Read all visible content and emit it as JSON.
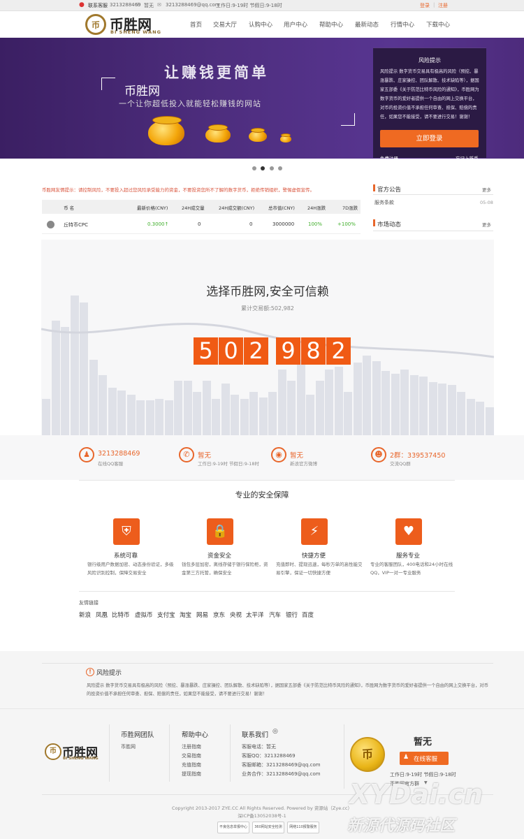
{
  "topbar": {
    "service_label": "联系客服",
    "qq": "3213288469",
    "phone": "暂无",
    "email": "3213288469@qq.com",
    "hours": "工作日:9-19时 节假日:9-18时",
    "login": "登录",
    "register": "注册",
    "separator": "|"
  },
  "nav": {
    "logo_cn": "币胜网",
    "logo_en": "BI SHENG WANG",
    "items": [
      "首页",
      "交易大厅",
      "认购中心",
      "用户中心",
      "帮助中心",
      "最新动态",
      "行情中心",
      "下载中心"
    ]
  },
  "banner": {
    "slogan": "让赚钱更简单",
    "brand": "币胜网",
    "tagline": "一个让你超低投入就能轻松赚钱的网站",
    "risk_title": "风险提示",
    "risk_text": "风险提示 数字货币交易具有极高的风险（预挖、暴涨暴跌、庄家操控、团队解散、技术缺陷等），据国家五部委《关于防范比特币风险的通知》，币胜网为数字货币的爱好者提供一个自由的网上交换平台，对币的投资价值不承担任何审查、担保、赔偿的责任，如果您不能接受，请不要进行交易！谢谢！",
    "login_button": "立即登录",
    "free_register": "免费注册",
    "forgot": "忘记上新币",
    "dots": 4,
    "active_dot": 1
  },
  "notice": "币胜网友情提示：请控制风险，不要投入超过您风险承受能力的资金，不要投资您所不了解的数字货币，拒绝传销组织，警惕虚假宣传。",
  "market": {
    "headers": [
      "币 名",
      "最新价格(CNY)",
      "24H成交量",
      "24H成交额(CNY)",
      "总市值(CNY)",
      "24H涨跌",
      "7D涨跌"
    ],
    "rows": [
      {
        "name": "丘特币CPC",
        "price": "0.3000↑",
        "volume": "0",
        "amount": "0",
        "cap": "3000000",
        "change24": "100%",
        "change7d": "+100%"
      }
    ]
  },
  "sidebar": {
    "announce_title": "官方公告",
    "announce_more": "更多",
    "announce_item": "服务条款",
    "announce_date": "05-08",
    "news_title": "市场动态",
    "news_more": "更多"
  },
  "stats": {
    "title": "选择币胜网,安全可信赖",
    "subtitle": "累计交易额:502,982",
    "digits": [
      "5",
      "0",
      "2",
      "9",
      "8",
      "2"
    ]
  },
  "contacts": [
    {
      "icon": "qq-icon",
      "title": "3213288469",
      "sub": "在线QQ客服"
    },
    {
      "icon": "phone-icon",
      "title": "暂无",
      "sub": "工作日:9-19时 节假日:9-18时"
    },
    {
      "icon": "weibo-icon",
      "title": "暂无",
      "sub": "新浪官方微博"
    },
    {
      "icon": "group-icon",
      "title": "2群：339537450",
      "sub": "交流QQ群"
    }
  ],
  "security": {
    "title": "专业的安全保障",
    "features": [
      {
        "icon": "shield-icon",
        "title": "系统可靠",
        "desc": "银行级用户数据加密、动态身份验证，多级风险识别控制，保障交易安全"
      },
      {
        "icon": "lock-icon",
        "title": "资金安全",
        "desc": "钱包多层加密，离线存储于银行保险柜，资金第三方托管，确保安全"
      },
      {
        "icon": "bolt-icon",
        "title": "快捷方便",
        "desc": "充值即时、提现迅速，每秒万单的高性能交易引擎，保证一切快捷方便"
      },
      {
        "icon": "heart-icon",
        "title": "服务专业",
        "desc": "专业的客服团队，400电话和24小时在线QQ，VIP一对一专业服务"
      }
    ]
  },
  "links": {
    "title": "友情链接",
    "items": [
      "新浪",
      "凤凰",
      "比特币",
      "虚拟币",
      "支付宝",
      "淘宝",
      "网易",
      "京东",
      "央视",
      "太平洋",
      "汽车",
      "银行",
      "百度"
    ]
  },
  "risk_footer": {
    "title": "风险提示",
    "text": "风险提示 数字货币交易具有极高的风险（预挖、暴涨暴跌、庄家操控、团队解散、技术缺陷等），据国家五部委《关于防范比特币风险的通知》，币胜网为数字货币的爱好者提供一个自由的网上交换平台，对币的投资价值不承担任何审查、担保、赔偿的责任，如果您不能接受，请不要进行交易！谢谢！"
  },
  "footer": {
    "col1_title": "币胜网团队",
    "col1_items": [
      "币胜网"
    ],
    "col2_title": "帮助中心",
    "col2_items": [
      "注册指南",
      "交易指南",
      "充值指南",
      "提现指南"
    ],
    "col3_title": "联系我们",
    "col3_items": [
      "客服电话：暂无",
      "客服QQ：3213288469",
      "客服邮箱：3213288469@qq.com",
      "业务合作：3213288469@qq.com"
    ],
    "service_title": "暂无",
    "online_button": "在线客服",
    "hours": "工作日:9-19时 节假日:9-18时",
    "group": "币胜网官方群",
    "copyright": "Copyright 2013-2017 ZYE.CC All Rights Reserved. Powered by 资源站（Zye.cc）",
    "icp": "深ICP备13052038号-1",
    "badges": [
      "不良信息举报中心",
      "360网站安全检测",
      "网络110报警服务"
    ],
    "watermark_en": "XYDai.cn",
    "watermark_cn": "新源代源码社区"
  },
  "colors": {
    "accent": "#ef6a22",
    "banner": "#4d2d7d",
    "green": "#3fae2a"
  }
}
